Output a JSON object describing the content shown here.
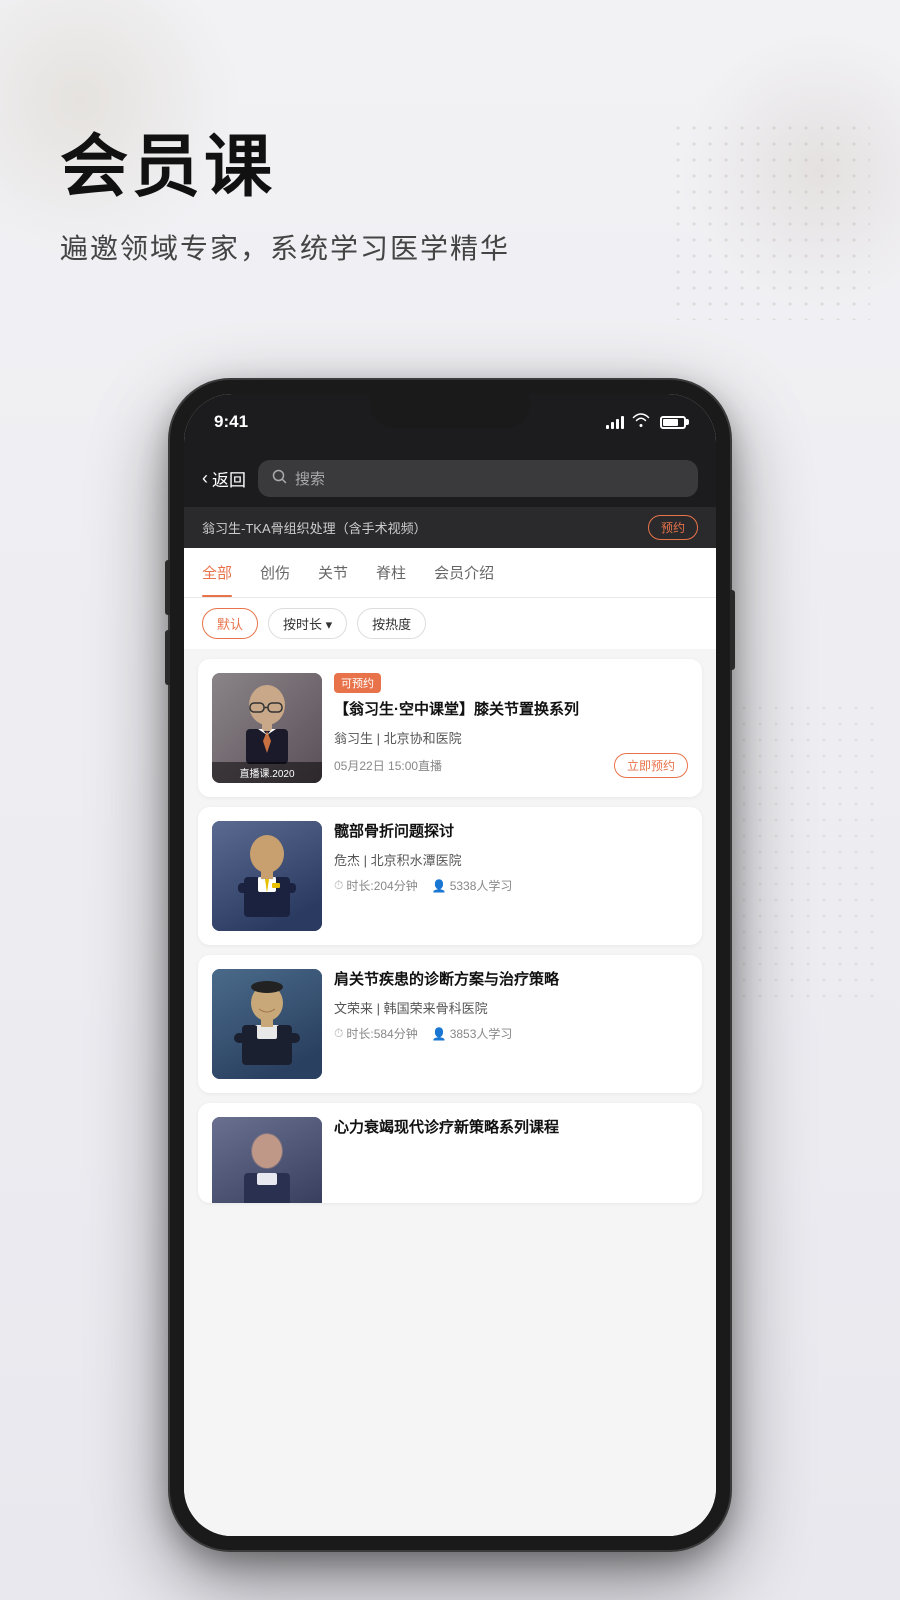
{
  "page": {
    "background": "#f0f0f0"
  },
  "hero": {
    "title": "会员课",
    "subtitle": "遍邀领域专家，系统学习医学精华"
  },
  "phone": {
    "status": {
      "time": "9:41"
    },
    "header": {
      "back_label": "返回",
      "search_placeholder": "搜索"
    },
    "banner": {
      "text": "翁习生-TKA骨组织处理（含手术视频）",
      "reserve_label": "预约"
    },
    "tabs": [
      {
        "label": "全部",
        "active": true
      },
      {
        "label": "创伤",
        "active": false
      },
      {
        "label": "关节",
        "active": false
      },
      {
        "label": "脊柱",
        "active": false
      },
      {
        "label": "会员介绍",
        "active": false
      }
    ],
    "filters": [
      {
        "label": "默认",
        "active": true
      },
      {
        "label": "按时长 ▾",
        "active": false
      },
      {
        "label": "按热度",
        "active": false
      }
    ],
    "courses": [
      {
        "id": 1,
        "tag": "可预约",
        "title": "【翁习生·空中课堂】膝关节置换系列",
        "doctor": "翁习生 | 北京协和医院",
        "time": "05月22日 15:00直播",
        "live_label": "立即预约",
        "thumb_label": "直播课.2020",
        "has_meta": false
      },
      {
        "id": 2,
        "tag": "",
        "title": "髋部骨折问题探讨",
        "doctor": "危杰 | 北京积水潭医院",
        "duration": "时长:204分钟",
        "learners": "5338人学习",
        "has_meta": true
      },
      {
        "id": 3,
        "tag": "",
        "title": "肩关节疾患的诊断方案与治疗策略",
        "doctor": "文荣来 | 韩国荣来骨科医院",
        "duration": "时长:584分钟",
        "learners": "3853人学习",
        "has_meta": true
      },
      {
        "id": 4,
        "tag": "",
        "title": "心力衰竭现代诊疗新策略系列课程",
        "doctor": "",
        "duration": "",
        "learners": "",
        "has_meta": false,
        "partial": true
      }
    ]
  }
}
